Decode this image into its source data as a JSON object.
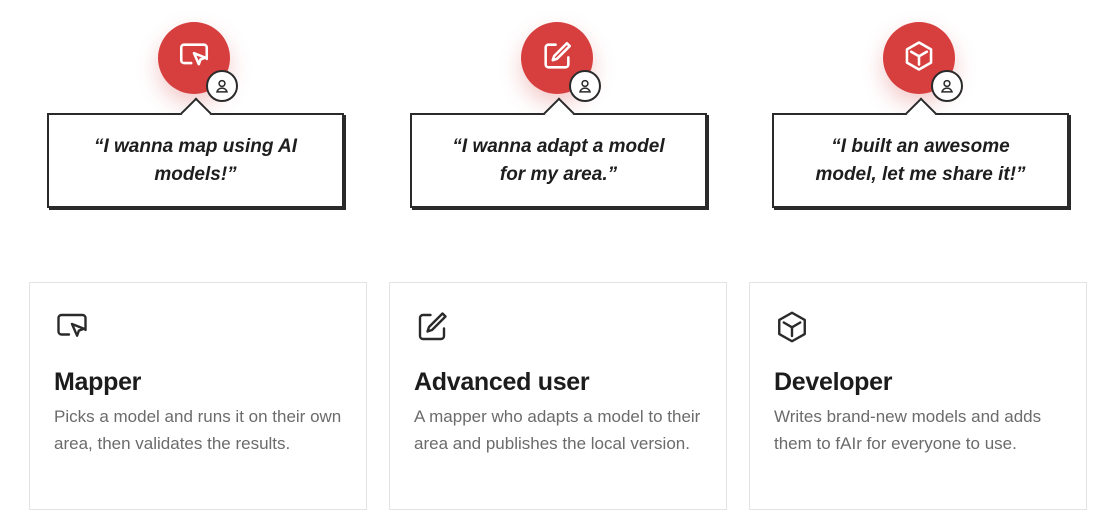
{
  "colors": {
    "accent": "#d73f3f",
    "border": "#2a2a2a",
    "muted_text": "#6b6b6b"
  },
  "personas": [
    {
      "icon": "cursor-screen-icon",
      "quote": "“I wanna map using AI models!”"
    },
    {
      "icon": "edit-square-icon",
      "quote": "“I wanna adapt a model for my area.”"
    },
    {
      "icon": "cube-icon",
      "quote": "“I built an awesome model, let me share it!”"
    }
  ],
  "cards": [
    {
      "icon": "cursor-screen-icon",
      "title": "Mapper",
      "description": "Picks a model and runs it on their own area, then validates the results."
    },
    {
      "icon": "edit-square-icon",
      "title": "Advanced user",
      "description": "A mapper who adapts a model to their area and publishes the local version."
    },
    {
      "icon": "cube-icon",
      "title": "Developer",
      "description": "Writes brand-new models and adds them to fAIr for everyone to use."
    }
  ]
}
